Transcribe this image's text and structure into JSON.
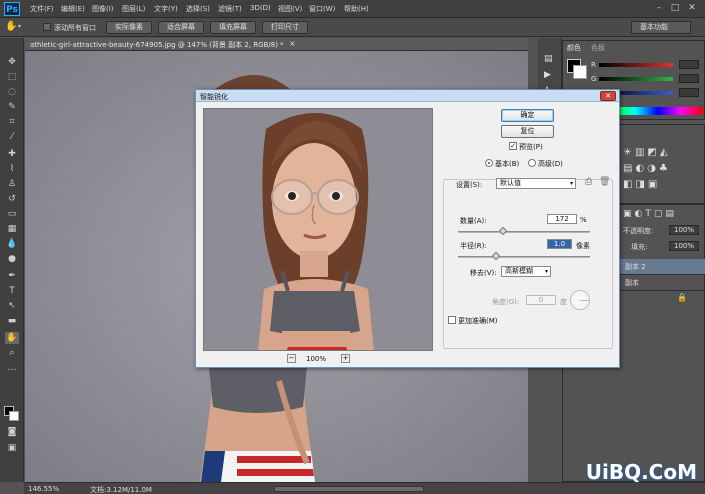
{
  "menubar": {
    "logo": "Ps",
    "items": [
      "文件(F)",
      "编辑(E)",
      "图像(I)",
      "图层(L)",
      "文字(Y)",
      "选择(S)",
      "滤镜(T)",
      "3D(D)",
      "视图(V)",
      "窗口(W)",
      "帮助(H)"
    ],
    "minimize": "–",
    "maximize": "□",
    "close": "✕"
  },
  "options": {
    "scroll_all": "滚动所有窗口",
    "actual_pixels": "实际像素",
    "fit_screen": "适合屏幕",
    "fill_screen": "填充屏幕",
    "print_size": "打印尺寸",
    "workspace": "基本功能"
  },
  "document": {
    "tab_title": "athletic-girl-attractive-beauty-674905.jpg @ 147% (背景 副本 2, RGB/8) *",
    "tab_close": "×"
  },
  "status": {
    "zoom": "146.55%",
    "doc": "文档:3.12M/11.0M"
  },
  "panels": {
    "color_tab": "颜色",
    "swatches_tab": "色板",
    "r": "R",
    "g": "G",
    "b": "B",
    "opacity_label": "不透明度:",
    "opacity_value": "100%",
    "fill_label": "填充:",
    "fill_value": "100%",
    "layer_1": "副本 2",
    "layer_2": "副本",
    "colors": {
      "r": "#e03131",
      "g": "#2fb344",
      "b": "#3b5bdb"
    }
  },
  "dialog": {
    "title": "智能锐化",
    "close": "✕",
    "ok": "确定",
    "reset": "复位",
    "preview_label": "预览(P)",
    "mode_basic": "基本(B)",
    "mode_advanced": "高级(D)",
    "settings_label": "设置(S):",
    "settings_value": "默认值",
    "amount_label": "数量(A):",
    "amount_value": "172",
    "amount_unit": "%",
    "amount": 172,
    "amount_max": 500,
    "radius_label": "半径(R):",
    "radius_value": "1.0",
    "radius_unit": "像素",
    "radius": 1.0,
    "radius_max": 64,
    "remove_label": "移去(V):",
    "remove_value": "高斯模糊",
    "angle_label": "角度(G):",
    "angle_value": "0",
    "angle_unit": "度",
    "more_accurate": "更加准确(M)",
    "zoom_level": "100%",
    "zoom_minus": "−",
    "zoom_plus": "+"
  },
  "watermark": "UiBQ.CoM"
}
